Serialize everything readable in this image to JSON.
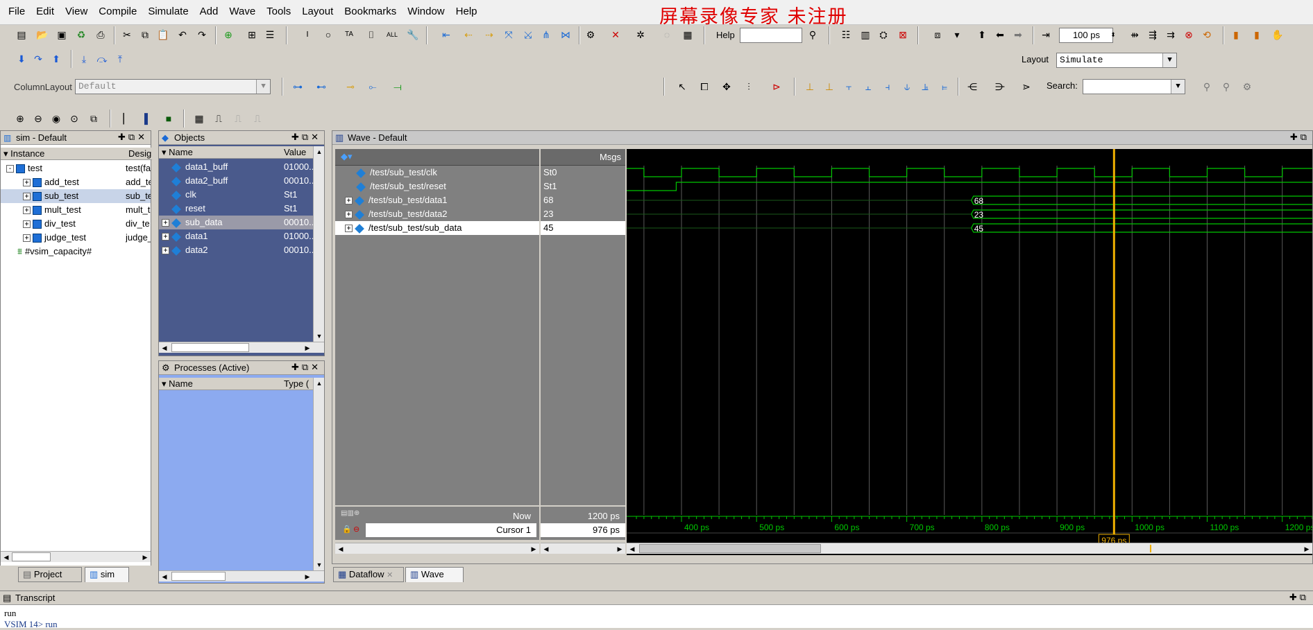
{
  "menu": [
    "File",
    "Edit",
    "View",
    "Compile",
    "Simulate",
    "Add",
    "Wave",
    "Tools",
    "Layout",
    "Bookmarks",
    "Window",
    "Help"
  ],
  "watermark": "屏幕录像专家  未注册",
  "toolbar": {
    "help_label": "Help",
    "help_value": "",
    "time_step": "100 ps",
    "layout_label": "Layout",
    "layout_value": "Simulate",
    "column_layout_label": "ColumnLayout",
    "column_layout_value": "Default",
    "search_label": "Search:",
    "search_value": ""
  },
  "sim_panel": {
    "title": "sim - Default",
    "col_instance": "Instance",
    "col_design": "Design",
    "rows": [
      {
        "name": "test",
        "design": "test(fa",
        "level": 0,
        "expander": "-"
      },
      {
        "name": "add_test",
        "design": "add_te",
        "level": 1,
        "expander": "+"
      },
      {
        "name": "sub_test",
        "design": "sub_te",
        "level": 1,
        "expander": "+",
        "selected": true
      },
      {
        "name": "mult_test",
        "design": "mult_t",
        "level": 1,
        "expander": "+"
      },
      {
        "name": "div_test",
        "design": "div_te",
        "level": 1,
        "expander": "+"
      },
      {
        "name": "judge_test",
        "design": "judge_",
        "level": 1,
        "expander": "+"
      },
      {
        "name": "#vsim_capacity#",
        "design": "",
        "level": 0,
        "expander": ""
      }
    ],
    "tabs": [
      "Project",
      "sim"
    ]
  },
  "objects_panel": {
    "title": "Objects",
    "col_name": "Name",
    "col_value": "Value",
    "rows": [
      {
        "name": "data1_buff",
        "value": "01000..",
        "expander": ""
      },
      {
        "name": "data2_buff",
        "value": "00010..",
        "expander": ""
      },
      {
        "name": "clk",
        "value": "St1",
        "expander": ""
      },
      {
        "name": "reset",
        "value": "St1",
        "expander": ""
      },
      {
        "name": "sub_data",
        "value": "00010..",
        "expander": "+",
        "highlight": true
      },
      {
        "name": "data1",
        "value": "01000..",
        "expander": "+"
      },
      {
        "name": "data2",
        "value": "00010..",
        "expander": "+"
      }
    ]
  },
  "processes_panel": {
    "title": "Processes (Active)",
    "col_name": "Name",
    "col_type": "Type ("
  },
  "wave": {
    "title": "Wave - Default",
    "msgs_header": "Msgs",
    "signals": [
      {
        "path": "/test/sub_test/clk",
        "value": "St0",
        "expander": ""
      },
      {
        "path": "/test/sub_test/reset",
        "value": "St1",
        "expander": ""
      },
      {
        "path": "/test/sub_test/data1",
        "value": "68",
        "expander": "+"
      },
      {
        "path": "/test/sub_test/data2",
        "value": "23",
        "expander": "+"
      },
      {
        "path": "/test/sub_test/sub_data",
        "value": "45",
        "expander": "+",
        "selected": true
      }
    ],
    "now_label": "Now",
    "now_value": "1200 ps",
    "cursor_label": "Cursor 1",
    "cursor_value": "976 ps",
    "cursor_marker": "976 ps",
    "cursor_time_ps": 976,
    "time_range_ps": [
      327,
      1240
    ],
    "ticks": [
      "400 ps",
      "500 ps",
      "600 ps",
      "700 ps",
      "800 ps",
      "900 ps",
      "1000 ps",
      "1100 ps",
      "1200 ps"
    ],
    "tick_values_ps": [
      400,
      500,
      600,
      700,
      800,
      900,
      1000,
      1100,
      1200
    ],
    "clk_period_ps": 100,
    "bus_change_ps": 786,
    "bus_labels": [
      "68",
      "23",
      "45"
    ],
    "colors": {
      "wave": "#00c800",
      "cursor": "#f0b000",
      "grid": "#5a5a5a",
      "background": "#000000"
    }
  },
  "bottom_tabs": [
    "Dataflow",
    "Wave"
  ],
  "transcript": {
    "title": "Transcript",
    "lines": [
      "run",
      "VSIM 14> run"
    ]
  }
}
